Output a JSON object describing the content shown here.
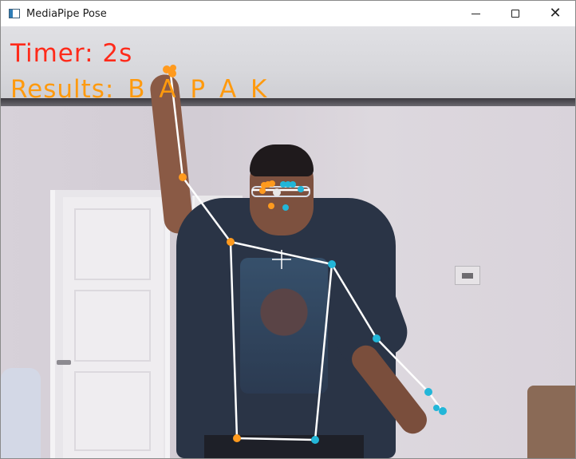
{
  "window": {
    "title": "MediaPipe Pose",
    "icon": "app-window-icon",
    "controls": {
      "minimize_icon": "minimize-icon",
      "maximize_icon": "maximize-icon",
      "close_icon": "close-icon"
    }
  },
  "overlay": {
    "timer_text": "Timer: 2s",
    "results_text": "Results: B A P A K",
    "colors": {
      "timer": "#ff2a1a",
      "results": "#ff9a0e",
      "skeleton_line": "#ffffff",
      "left_landmark": "#ff9a1e",
      "right_landmark": "#22b6d8"
    }
  }
}
